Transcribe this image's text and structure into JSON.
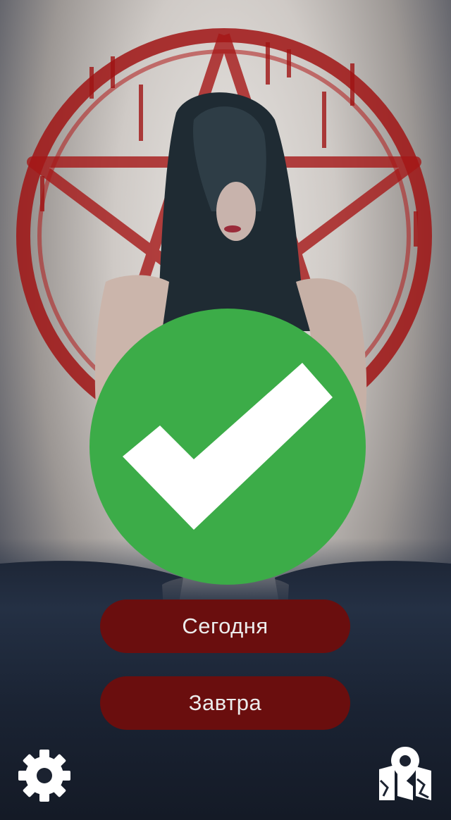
{
  "buttons": {
    "today_label": "Сегодня",
    "tomorrow_label": "Завтра"
  },
  "status": {
    "icon": "check-icon",
    "color": "#3cac48"
  },
  "toolbar": {
    "settings_icon": "gear-icon",
    "map_icon": "map-pin-icon"
  },
  "colors": {
    "button_bg": "#6a0e0e",
    "button_text": "#ececec",
    "icon": "#ffffff"
  }
}
